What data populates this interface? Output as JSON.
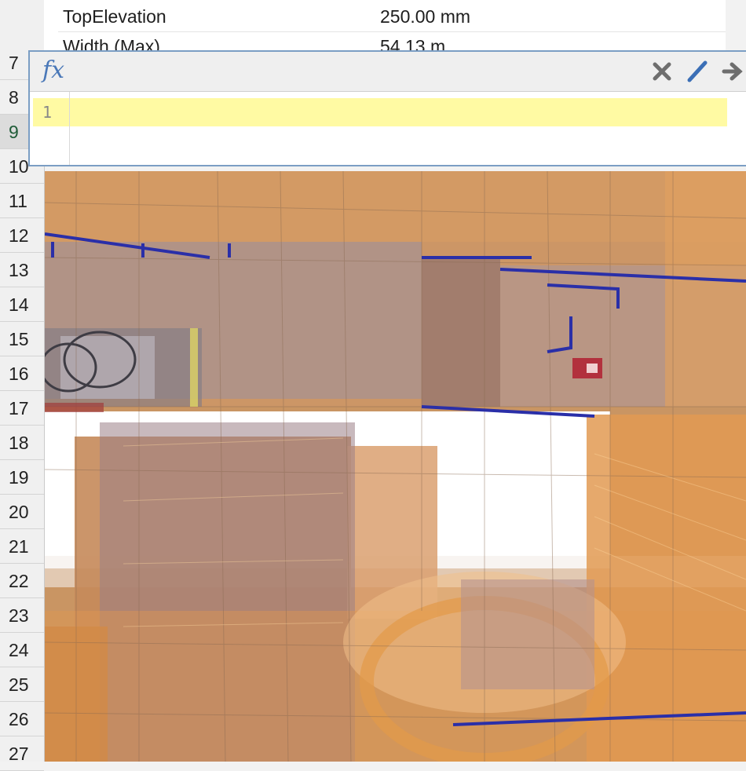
{
  "spreadsheet": {
    "row_numbers": [
      "7",
      "8",
      "9",
      "10",
      "11",
      "12",
      "13",
      "14",
      "15",
      "16",
      "17",
      "18",
      "19",
      "20",
      "21",
      "22",
      "23",
      "24",
      "25",
      "26",
      "27"
    ],
    "selected_row": "9"
  },
  "properties": [
    {
      "name": "TopElevation",
      "value": "250.00 mm"
    },
    {
      "name": "Width (Max)",
      "value": "54.13 m"
    }
  ],
  "formula_editor": {
    "fx_label": "fx",
    "line_numbers": [
      "1"
    ],
    "code": "",
    "actions": [
      {
        "id": "cancel",
        "icon": "close-icon",
        "color": "#6e6e6e"
      },
      {
        "id": "edit",
        "icon": "pencil-icon",
        "color": "#3b6fb6"
      },
      {
        "id": "apply",
        "icon": "arrow-right-icon",
        "color": "#6e6e6e"
      }
    ],
    "highlight_color": "#fffaa3"
  },
  "viewport": {
    "content": "3D model view",
    "colors": {
      "orange": "#e8a157",
      "beige": "#d9a878",
      "slate": "#8b8696",
      "pipe_blue": "#2a2fa8",
      "white": "#ffffff"
    }
  }
}
